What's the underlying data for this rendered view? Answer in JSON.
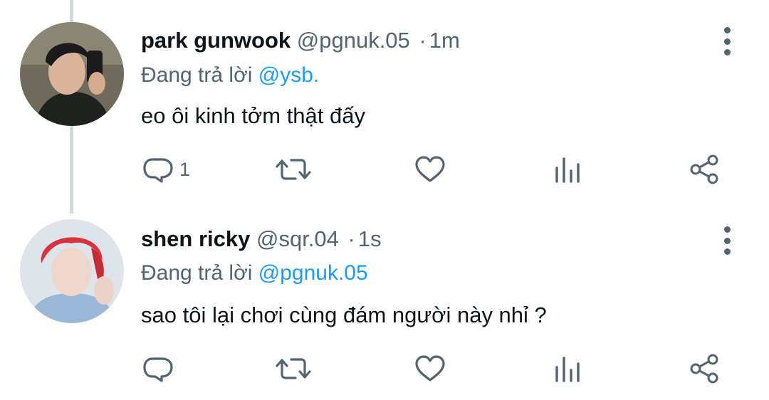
{
  "tweets": [
    {
      "name": "park gunwook",
      "handle": "@pgnuk.05",
      "separator": "·",
      "time": "1m",
      "reply_prefix": "Đang trả lời",
      "reply_handle": "@ysb.",
      "content": "eo ôi kinh tởm thật đấy",
      "reply_count": "1",
      "avatar_icon": "user-photo-avatar"
    },
    {
      "name": "shen ricky",
      "handle": "@sqr.04",
      "separator": "·",
      "time": "1s",
      "reply_prefix": "Đang trả lời",
      "reply_handle": "@pgnuk.05",
      "content": "sao tôi lại chơi cùng đám người này nhỉ ?",
      "reply_count": "",
      "avatar_icon": "user-photo-avatar"
    }
  ],
  "colors": {
    "text_primary": "#0f1419",
    "text_secondary": "#536471",
    "link": "#1d9bf0",
    "thread_line": "#cfd9de"
  },
  "action_icons": [
    "reply-icon",
    "retweet-icon",
    "like-icon",
    "views-icon",
    "share-icon"
  ]
}
